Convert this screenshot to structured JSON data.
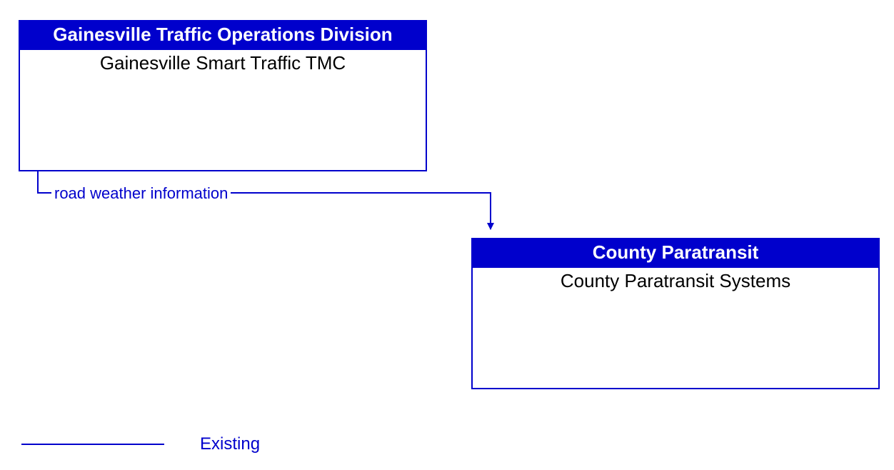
{
  "nodes": {
    "nodeA": {
      "header": "Gainesville Traffic Operations Division",
      "body": "Gainesville Smart Traffic TMC"
    },
    "nodeB": {
      "header": "County Paratransit",
      "body": "County Paratransit Systems"
    }
  },
  "flow": {
    "label": "road weather information"
  },
  "legend": {
    "existing": "Existing"
  },
  "colors": {
    "stroke": "#0000cc",
    "headerBg": "#0000cc",
    "headerText": "#ffffff",
    "bodyText": "#000000"
  }
}
